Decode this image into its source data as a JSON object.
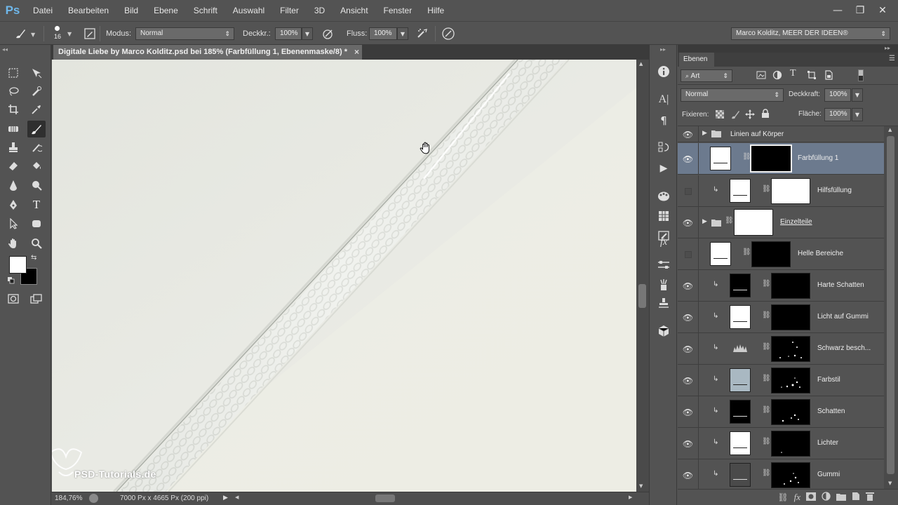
{
  "app": {
    "logo": "Ps"
  },
  "menu": [
    "Datei",
    "Bearbeiten",
    "Bild",
    "Ebene",
    "Schrift",
    "Auswahl",
    "Filter",
    "3D",
    "Ansicht",
    "Fenster",
    "Hilfe"
  ],
  "window_controls": {
    "minimize": "—",
    "maximize": "❐",
    "close": "✕"
  },
  "options": {
    "brush_size": "16",
    "modus_label": "Modus:",
    "modus_value": "Normal",
    "deckkraft_label": "Deckkr.:",
    "deckkraft_value": "100%",
    "fluss_label": "Fluss:",
    "fluss_value": "100%",
    "workspace": "Marco Kolditz, MEER DER IDEEN®"
  },
  "document": {
    "tab_title": "Digitale Liebe by Marco Kolditz.psd bei 185% (Farbfüllung 1, Ebenenmaske/8) *",
    "tab_close": "×",
    "watermark": "PSD-Tutorials.de"
  },
  "status": {
    "zoom": "184,76%",
    "doc_size": "7000 Px x 4665 Px (200 ppi)"
  },
  "layers_panel": {
    "tab": "Ebenen",
    "filter_value": "Art",
    "blend_mode": "Normal",
    "opacity_label": "Deckkraft:",
    "opacity_value": "100%",
    "lock_label": "Fixieren:",
    "fill_label": "Fläche:",
    "fill_value": "100%",
    "layers": [
      {
        "name": "Linien auf Körper",
        "kind": "group",
        "visible": true
      },
      {
        "name": "Farbfüllung 1",
        "kind": "fill",
        "visible": true,
        "selected": true
      },
      {
        "name": "Hilfsfüllung",
        "kind": "clip",
        "visible": false
      },
      {
        "name": "Einzelteile",
        "kind": "group",
        "visible": true
      },
      {
        "name": "Helle Bereiche",
        "kind": "fill",
        "visible": false
      },
      {
        "name": "Harte Schatten",
        "kind": "clip",
        "visible": true
      },
      {
        "name": "Licht auf Gummi",
        "kind": "clip",
        "visible": true
      },
      {
        "name": "Schwarz besch...",
        "kind": "clip",
        "visible": true
      },
      {
        "name": "Farbstil",
        "kind": "clip",
        "visible": true
      },
      {
        "name": "Schatten",
        "kind": "clip",
        "visible": true
      },
      {
        "name": "Lichter",
        "kind": "clip",
        "visible": true
      },
      {
        "name": "Gummi",
        "kind": "clip",
        "visible": true
      }
    ]
  },
  "colors": {
    "foreground": "#ffffff",
    "background": "#000000",
    "selected_row": "#6c7a8e",
    "farbstil_thumb": "#a9b8c2"
  }
}
